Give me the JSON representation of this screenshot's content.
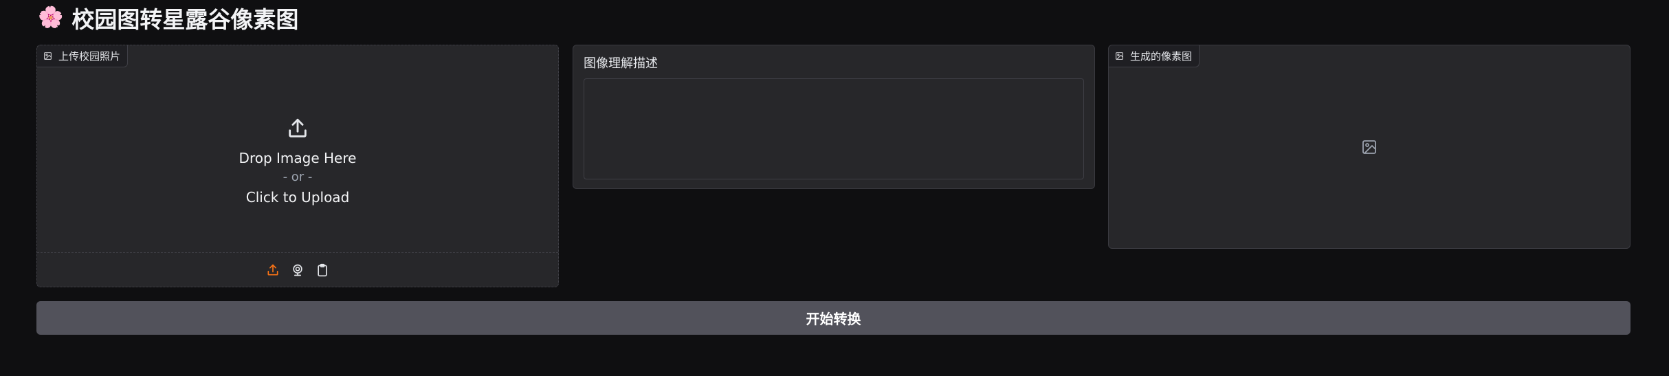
{
  "app": {
    "title_emoji": "🌸",
    "title": "校园图转星露谷像素图"
  },
  "upload_panel": {
    "label": "上传校园照片",
    "label_icon": "image-icon",
    "drop_line1": "Drop Image Here",
    "drop_line2": "- or -",
    "drop_line3": "Click to Upload",
    "sources": [
      {
        "name": "upload-source-icon",
        "active": true
      },
      {
        "name": "webcam-source-icon",
        "active": false
      },
      {
        "name": "clipboard-source-icon",
        "active": false
      }
    ],
    "accent_color": "#f97316"
  },
  "description_panel": {
    "label": "图像理解描述",
    "value": ""
  },
  "output_panel": {
    "label": "生成的像素图",
    "label_icon": "image-icon",
    "placeholder_icon": "image-icon"
  },
  "actions": {
    "start_label": "开始转换"
  },
  "theme": {
    "background": "#0f0f11",
    "panel": "#27272a",
    "button": "#52525b"
  }
}
